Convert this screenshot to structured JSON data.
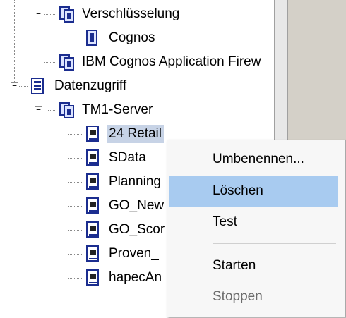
{
  "tree": {
    "nodes": [
      {
        "id": "verschluesselung",
        "label": "Verschlüsselung",
        "icon": "group-folder-icon"
      },
      {
        "id": "cognos",
        "label": "Cognos",
        "icon": "document-icon"
      },
      {
        "id": "firewall",
        "label": "IBM Cognos Application Firew",
        "icon": "group-folder-icon"
      },
      {
        "id": "datenzugriff",
        "label": "Datenzugriff",
        "icon": "database-icon"
      },
      {
        "id": "tm1-server",
        "label": "TM1-Server",
        "icon": "group-folder-icon"
      },
      {
        "id": "24-retail",
        "label": "24 Retail",
        "icon": "server-icon",
        "selected": true
      },
      {
        "id": "sdata",
        "label": "SData",
        "icon": "server-icon"
      },
      {
        "id": "planning",
        "label": "Planning",
        "icon": "server-icon"
      },
      {
        "id": "go-new",
        "label": "GO_New",
        "icon": "server-icon"
      },
      {
        "id": "go-scor",
        "label": "GO_Scor",
        "icon": "server-icon"
      },
      {
        "id": "proven",
        "label": "Proven_",
        "icon": "server-icon"
      },
      {
        "id": "hapecan",
        "label": "hapecAn",
        "icon": "server-icon"
      }
    ]
  },
  "context_menu": {
    "items": [
      {
        "label": "Umbenennen...",
        "highlighted": false,
        "disabled": false
      },
      {
        "label": "Löschen",
        "highlighted": true,
        "disabled": false
      },
      {
        "label": "Test",
        "highlighted": false,
        "disabled": false
      },
      {
        "label": "Starten",
        "highlighted": false,
        "disabled": false
      },
      {
        "label": "Stoppen",
        "highlighted": false,
        "disabled": true
      }
    ]
  },
  "colors": {
    "selection": "#c7d3e6",
    "menu_highlight": "#a8cbf0",
    "icon_blue": "#1b2d8f"
  }
}
